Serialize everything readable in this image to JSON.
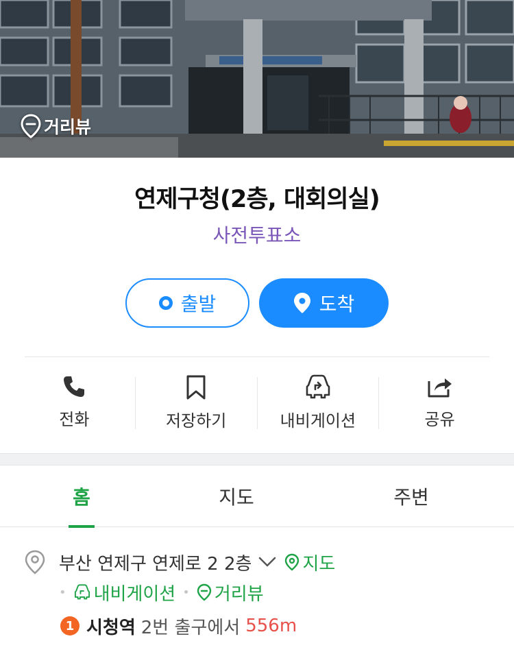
{
  "streetview": {
    "badge_label": "거리뷰"
  },
  "place": {
    "title": "연제구청(2층, 대회의실)",
    "category": "사전투표소"
  },
  "route_buttons": {
    "start_label": "출발",
    "arrive_label": "도착"
  },
  "actions": [
    {
      "label": "전화",
      "icon": "phone-icon"
    },
    {
      "label": "저장하기",
      "icon": "bookmark-icon"
    },
    {
      "label": "내비게이션",
      "icon": "car-navigation-icon"
    },
    {
      "label": "공유",
      "icon": "share-icon"
    }
  ],
  "tabs": [
    {
      "label": "홈",
      "active": true
    },
    {
      "label": "지도",
      "active": false
    },
    {
      "label": "주변",
      "active": false
    }
  ],
  "address": {
    "text": "부산 연제구 연제로 2 2층",
    "map_link": "지도",
    "navigation_link": "내비게이션",
    "streetview_link": "거리뷰"
  },
  "transit": {
    "line_number": "1",
    "station": "시청역",
    "exit_text": "2번 출구에서",
    "distance": "556m"
  },
  "colors": {
    "accent_blue": "#1a8cff",
    "accent_green": "#1fa347",
    "category_purple": "#7a56b8",
    "distance_red": "#e8504a",
    "line1_orange": "#f26522"
  }
}
